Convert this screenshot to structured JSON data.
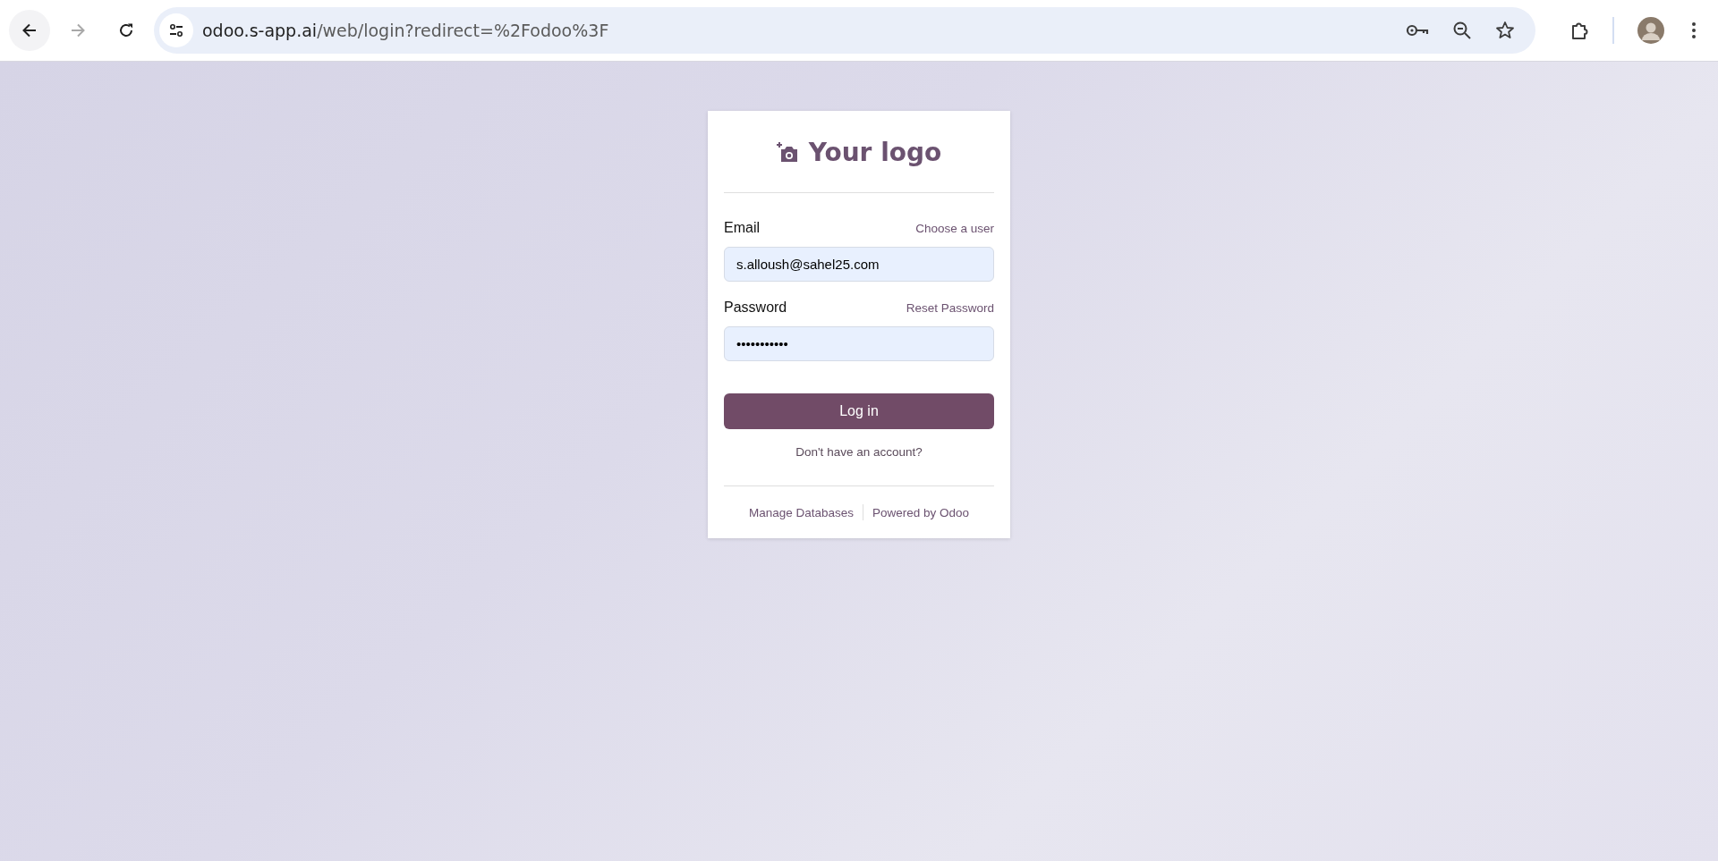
{
  "browser": {
    "url_host": "odoo.s-app.ai",
    "url_path": "/web/login?redirect=%2Fodoo%3F",
    "forward_disabled": true
  },
  "login": {
    "logo_text": "Your logo",
    "fields": [
      {
        "label": "Email",
        "link": "Choose a user",
        "value": "s.alloush@sahel25.com"
      },
      {
        "label": "Password",
        "link": "Reset Password",
        "value": "•••••••••••"
      }
    ],
    "submit": "Log in",
    "signup_link": "Don't have an account?",
    "footer_links": [
      "Manage Databases",
      "Powered by Odoo"
    ]
  }
}
